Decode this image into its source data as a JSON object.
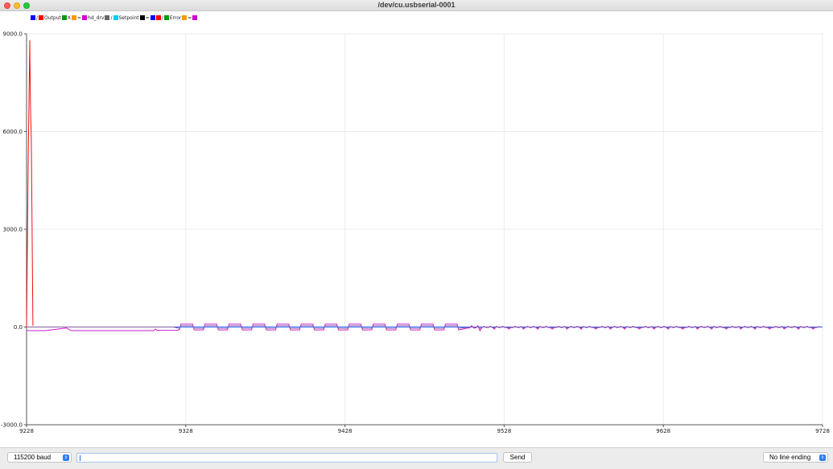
{
  "window": {
    "title": "/dev/cu.usbserial-0001"
  },
  "legend": [
    {
      "color": "#0000ff",
      "label": "/"
    },
    {
      "color": "#ff0000",
      "label": "Output"
    },
    {
      "color": "#009900",
      "label": "X"
    },
    {
      "color": "#ff9900",
      "label": "="
    },
    {
      "color": "#cc00cc",
      "label": "hd_drv"
    },
    {
      "color": "#666666",
      "label": "/"
    },
    {
      "color": "#00ccff",
      "label": "Setpoint"
    },
    {
      "color": "#000000",
      "label": "="
    },
    {
      "color": "#0000ff",
      "label": ""
    },
    {
      "color": "#ff0000",
      "label": "/"
    },
    {
      "color": "#009900",
      "label": "Error"
    },
    {
      "color": "#ff9900",
      "label": "="
    },
    {
      "color": "#cc00cc",
      "label": ""
    }
  ],
  "chart_data": {
    "type": "line",
    "xlim": [
      9228,
      9728
    ],
    "ylim": [
      -3000,
      9000
    ],
    "x_ticks": [
      "9228",
      "9328",
      "9428",
      "9528",
      "9628",
      "9728"
    ],
    "y_ticks": [
      "9000.0",
      "6000.0",
      "3000.0",
      "0.0",
      "-3000.0"
    ],
    "grid": true,
    "series": [
      {
        "name": "Output",
        "color": "#ee1111",
        "points": [
          [
            9228,
            0
          ],
          [
            9229,
            5000
          ],
          [
            9230,
            8800
          ],
          [
            9230.5,
            6700
          ],
          [
            9231,
            5800
          ],
          [
            9232,
            40
          ]
        ],
        "square_wave": null
      },
      {
        "name": "hd_drv",
        "color": "#cc22cc",
        "points": [
          [
            9228,
            -110
          ],
          [
            9240,
            -110
          ],
          [
            9253,
            -30
          ],
          [
            9256,
            -110
          ],
          [
            9308,
            -110
          ],
          [
            9309,
            -60
          ],
          [
            9310,
            -100
          ],
          [
            9323,
            -100
          ],
          [
            9324,
            -60
          ]
        ],
        "square_wave": {
          "start": 9324,
          "end": 9505,
          "period": 15.1,
          "high": 90,
          "low": -90,
          "noise_start": 9505,
          "noise_end": 9727
        }
      },
      {
        "name": "Setpoint",
        "color": "#1a5cff",
        "points": [
          [
            9228,
            0
          ],
          [
            9728,
            0
          ]
        ],
        "square_wave": null
      },
      {
        "name": "X",
        "color": "#8a5fa0",
        "points": [
          [
            9228,
            0
          ],
          [
            9320,
            0
          ]
        ],
        "square_wave": {
          "start": 9324,
          "end": 9505,
          "period": 15.1,
          "high": 40,
          "low": -40,
          "noise_start": 9505,
          "noise_end": 9727
        }
      }
    ]
  },
  "bottom": {
    "baud": "115200 baud",
    "input_value": "",
    "send": "Send",
    "line_ending": "No line ending"
  }
}
